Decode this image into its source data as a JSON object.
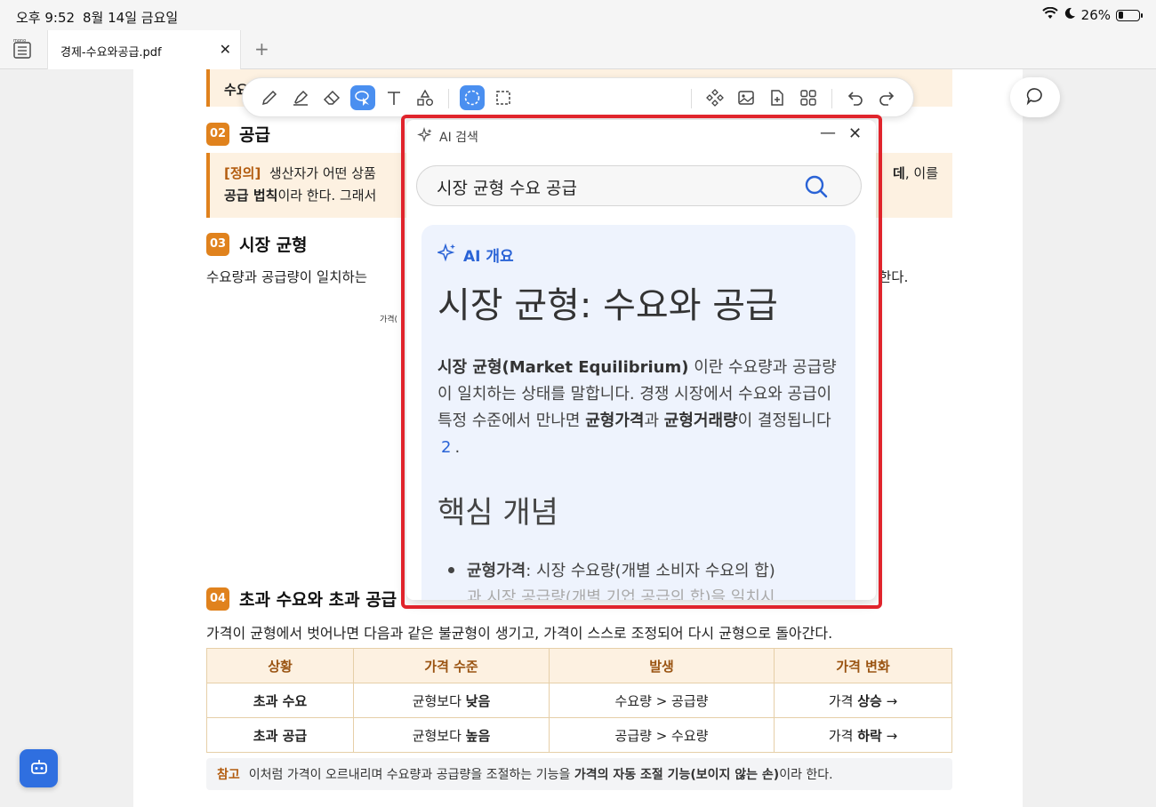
{
  "status": {
    "time": "오후 9:52",
    "date": "8월 14일 금요일",
    "battery": "26%",
    "battery_level": 0.26
  },
  "tabs": {
    "active_label": "경제-수요와공급.pdf",
    "close": "✕",
    "add": "+"
  },
  "doc": {
    "top_partial": "수요",
    "sec02": {
      "num": "02",
      "title": "공급"
    },
    "def02": {
      "tag": "[정의]",
      "text1": "생산자가 어떤 상품",
      "tail1": ", 이를",
      "bold_tail": "데",
      "bold2": "공급 법칙",
      "text2": "이라 한다. 그래서"
    },
    "sec03": {
      "num": "03",
      "title": "시장 균형"
    },
    "sec03_text_left": "수요량과 공급량이 일치하는",
    "sec03_text_right": "한다.",
    "chart_label": "가격(",
    "sec04": {
      "num": "04",
      "title": "초과 수요와 초과 공급"
    },
    "sec04_text": "가격이 균형에서 벗어나면 다음과 같은 불균형이 생기고, 가격이 스스로 조정되어 다시 균형으로 돌아간다.",
    "table": {
      "headers": [
        "상황",
        "가격 수준",
        "발생",
        "가격 변화"
      ],
      "rows": [
        [
          "초과 수요",
          "균형보다 낮음",
          "수요량 > 공급량",
          "가격 상승 →"
        ],
        [
          "초과 공급",
          "균형보다 높음",
          "공급량 > 수요량",
          "가격 하락 →"
        ]
      ]
    },
    "note": {
      "tag": "참고",
      "text": "이처럼 가격이 오르내리며 수요량과 공급량을 조절하는 기능을",
      "bold": "가격의 자동 조절 기능(보이지 않는 손)",
      "tail": "이라 한다."
    }
  },
  "ai": {
    "title": "AI 검색",
    "minimize": "—",
    "close": "✕",
    "query": "시장 균형 수요 공급",
    "overview_label": "AI 개요",
    "heading": "시장 균형: 수요와 공급",
    "para_bold1": "시장 균형(Market Equilibrium)",
    "para_text1": "이란 수요량과 공급량이 일치하는 상태를 말합니다. 경쟁 시장에서 수요와 공급이 특정 수준에서 만나면",
    "para_bold2": "균형가격",
    "para_text2": "과",
    "para_bold3": "균형거래량",
    "para_text3": "이 결정됩니다",
    "cite": "2",
    "para_end": ".",
    "subheading": "핵심 개념",
    "bullet1_bold": "균형가격",
    "bullet1_text": ": 시장 수요량(개별 소비자 수요의 합)",
    "bullet1_line2": "과 시장 공급량(개별 기업 공급의 합)을 일치시"
  }
}
